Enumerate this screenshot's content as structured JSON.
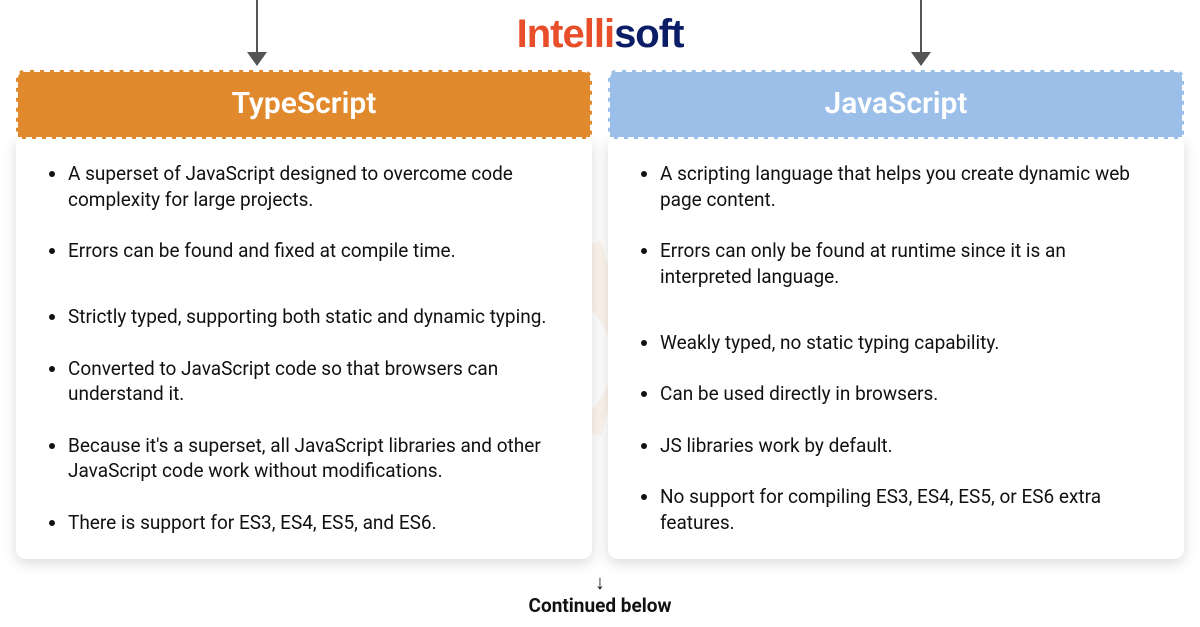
{
  "logo": {
    "part1": "Intelli",
    "part2": "soft"
  },
  "columns": [
    {
      "title": "TypeScript",
      "accent": "#e08a2d",
      "points": [
        "A superset of JavaScript designed to overcome code complexity for large projects.",
        "Errors can be found and fixed at compile time.",
        "Strictly typed, supporting both static and dynamic typing.",
        "Converted to JavaScript code so that browsers can understand it.",
        "Because it's a superset, all JavaScript libraries and other JavaScript code work without modifications.",
        "There is support for ES3, ES4, ES5, and ES6."
      ]
    },
    {
      "title": "JavaScript",
      "accent": "#9bbfe9",
      "points": [
        "A scripting language that helps you create dynamic web page content.",
        "Errors can only be found at runtime since it is an interpreted language.",
        "Weakly typed, no static typing capability.",
        "Can be used directly in browsers.",
        "JS libraries work by default.",
        "No support for compiling ES3, ES4, ES5, or ES6 extra features."
      ]
    }
  ],
  "footer": {
    "arrow": "↓",
    "label": "Continued below"
  }
}
